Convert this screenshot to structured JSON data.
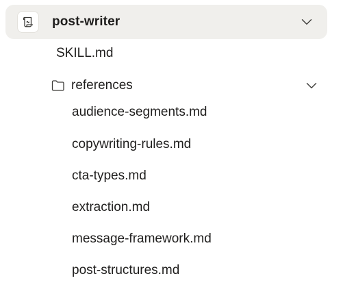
{
  "skill": {
    "name": "post-writer",
    "icon": "scroll-icon",
    "expanded": true
  },
  "files": {
    "skill_md": "SKILL.md"
  },
  "references_folder": {
    "label": "references",
    "icon": "folder-icon",
    "expanded": true,
    "items": [
      "audience-segments.md",
      "copywriting-rules.md",
      "cta-types.md",
      "extraction.md",
      "message-framework.md",
      "post-structures.md"
    ]
  }
}
